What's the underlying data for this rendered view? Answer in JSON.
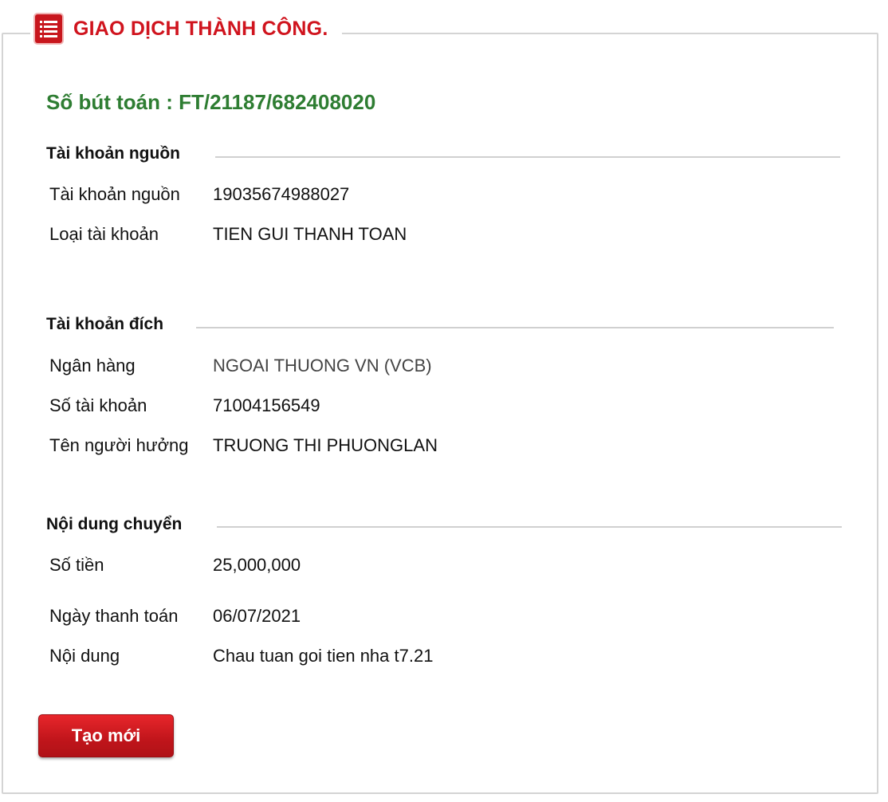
{
  "header": {
    "title": "GIAO DỊCH THÀNH CÔNG.",
    "icon": "list-icon",
    "accent_color": "#d0141e"
  },
  "reference": {
    "text": "Số bút toán : FT/21187/682408020",
    "color": "#2e7d32"
  },
  "source_account": {
    "heading": "Tài khoản nguồn",
    "rows": [
      {
        "label": "Tài khoản nguồn",
        "value": "19035674988027"
      },
      {
        "label": "Loại tài khoản",
        "value": "TIEN GUI THANH TOAN"
      }
    ]
  },
  "destination_account": {
    "heading": "Tài khoản đích",
    "rows": [
      {
        "label": "Ngân hàng",
        "value": "NGOAI THUONG VN (VCB)"
      },
      {
        "label": "Số tài khoản",
        "value": "71004156549"
      },
      {
        "label": "Tên người hưởng",
        "value": "TRUONG THI PHUONGLAN"
      }
    ]
  },
  "transfer_details": {
    "heading": "Nội dung chuyển",
    "rows": [
      {
        "label": "Số tiền",
        "value": "25,000,000"
      },
      {
        "label": "Ngày thanh toán",
        "value": "06/07/2021"
      },
      {
        "label": "Nội dung",
        "value": "Chau tuan goi tien nha t7.21"
      }
    ]
  },
  "actions": {
    "new_label": "Tạo mới"
  }
}
